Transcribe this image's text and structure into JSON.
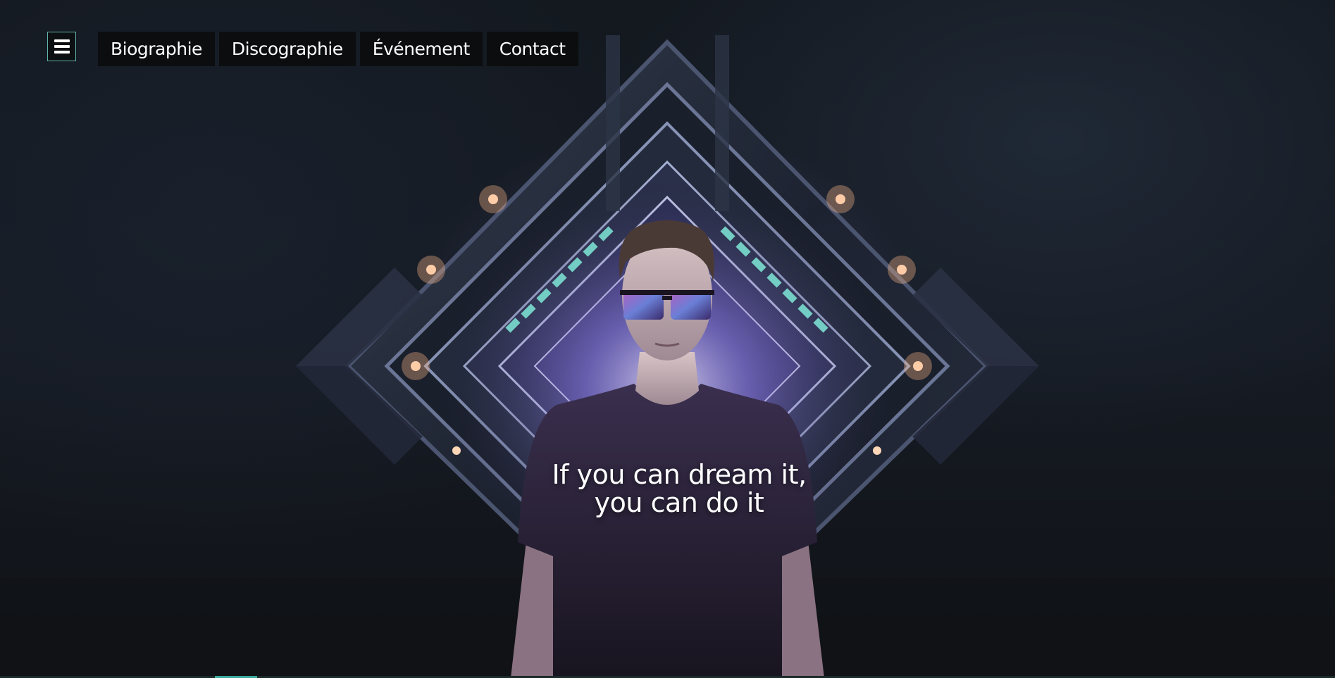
{
  "header": {
    "menu_icon": "hamburger-icon",
    "nav_items": [
      {
        "label": "Biographie"
      },
      {
        "label": "Discographie"
      },
      {
        "label": "Événement"
      },
      {
        "label": "Contact"
      }
    ]
  },
  "hero": {
    "tagline_line1": "If you can dream it,",
    "tagline_line2": "you can do it"
  },
  "colors": {
    "accent": "#3ea89a",
    "nav_bg": "#0a0b0d",
    "glow": "#7a6fd0",
    "teal_light": "#7fe8d8"
  }
}
